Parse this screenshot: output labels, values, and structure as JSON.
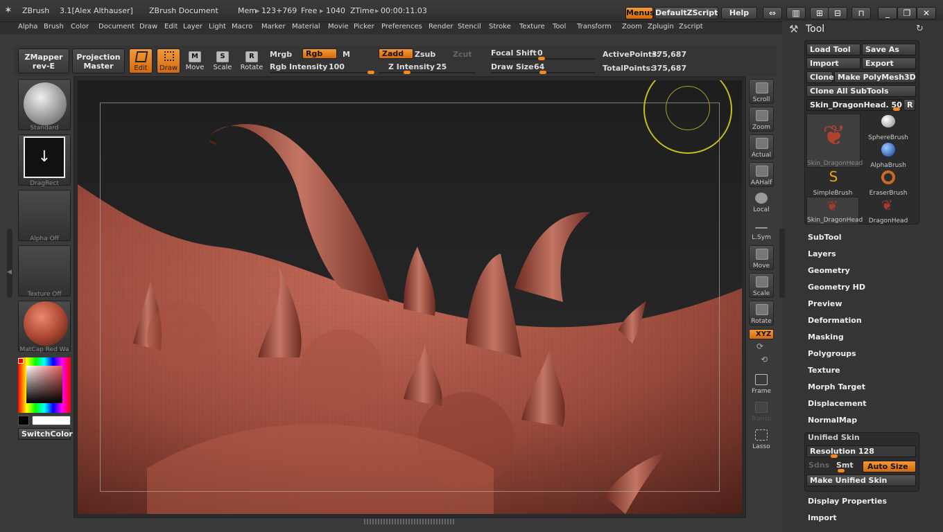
{
  "titlebar": {
    "app": "ZBrush",
    "version": "3.1[Alex Althauser]",
    "document": "ZBrush Document",
    "mem_label": "Mem",
    "mem_value": "123+769",
    "free_label": "Free",
    "free_value": "1040",
    "ztime_label": "ZTime",
    "ztime_value": "00:00:11.03",
    "menus_btn": "Menus",
    "script_btn": "DefaultZScript",
    "help_btn": "Help"
  },
  "menubar": [
    "Alpha",
    "Brush",
    "Color",
    "Document",
    "Draw",
    "Edit",
    "Layer",
    "Light",
    "Macro",
    "Marker",
    "Material",
    "Movie",
    "Picker",
    "Preferences",
    "Render",
    "Stencil",
    "Stroke",
    "Texture",
    "Tool",
    "Transform",
    "Zoom",
    "Zplugin",
    "Zscript"
  ],
  "toolbar": {
    "zmapper_l1": "ZMapper",
    "zmapper_l2": "rev-E",
    "projection_l1": "Projection",
    "projection_l2": "Master",
    "edit": "Edit",
    "draw": "Draw",
    "move": "Move",
    "scale": "Scale",
    "rotate": "Rotate",
    "mrgb": "Mrgb",
    "rgb": "Rgb",
    "m": "M",
    "rgb_intensity_label": "Rgb Intensity",
    "rgb_intensity_value": "100",
    "zadd": "Zadd",
    "zsub": "Zsub",
    "zcut": "Zcut",
    "z_intensity_label": "Z Intensity",
    "z_intensity_value": "25",
    "focal_shift_label": "Focal Shift",
    "focal_shift_value": "0",
    "draw_size_label": "Draw Size",
    "draw_size_value": "64",
    "active_points_label": "ActivePoints:",
    "active_points_value": "375,687",
    "total_points_label": "TotalPoints:",
    "total_points_value": "375,687"
  },
  "left_shelf": {
    "brush": "Standard",
    "stroke": "DragRect",
    "alpha": "Alpha Off",
    "texture": "Texture Off",
    "material": "MatCap Red Wa",
    "switch_color": "SwitchColor"
  },
  "right_shelf": [
    "Scroll",
    "Zoom",
    "Actual",
    "AAHalf",
    "Local",
    "L.Sym",
    "Move",
    "Scale",
    "Rotate",
    "Frame",
    "Transp",
    "Lasso"
  ],
  "xyz_label": "XYZ",
  "tool_panel": {
    "title": "Tool",
    "load_tool": "Load Tool",
    "save_as": "Save As",
    "import": "Import",
    "export": "Export",
    "clone": "Clone",
    "make_polymesh": "Make PolyMesh3D",
    "clone_all": "Clone All SubTools",
    "current_tool_slider": "Skin_DragonHead. 50",
    "r_btn": "R",
    "thumbs": [
      "Skin_DragonHead",
      "SphereBrush",
      "AlphaBrush",
      "SimpleBrush",
      "EraserBrush",
      "Skin_DragonHead",
      "DragonHead"
    ],
    "sections": [
      "SubTool",
      "Layers",
      "Geometry",
      "Geometry HD",
      "Preview",
      "Deformation",
      "Masking",
      "Polygroups",
      "Texture",
      "Morph Target",
      "Displacement",
      "NormalMap"
    ],
    "unified_skin": {
      "title": "Unified Skin",
      "resolution_label": "Resolution",
      "resolution_value": "128",
      "sdns": "Sdns",
      "smt": "Smt",
      "auto_size": "Auto Size",
      "make_btn": "Make Unified Skin"
    },
    "sections_after": [
      "Display Properties",
      "Import"
    ]
  },
  "colors": {
    "accent": "#f28a1f",
    "panel": "#353535",
    "model": "#9a4a3c"
  }
}
